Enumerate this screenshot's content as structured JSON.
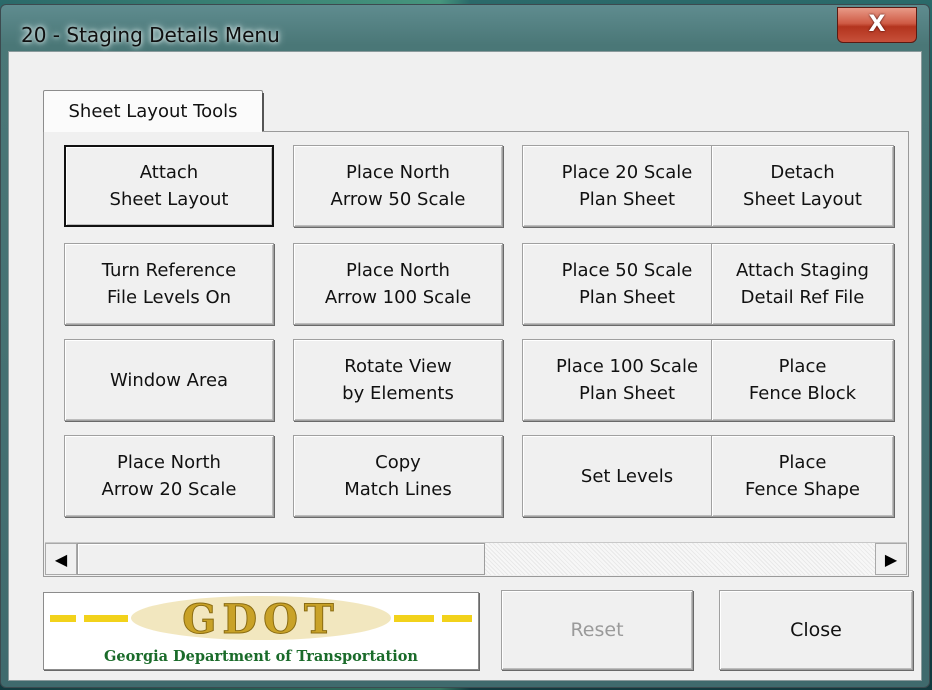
{
  "window": {
    "title": "20 - Staging Details Menu",
    "close_glyph": "X"
  },
  "tabs": [
    {
      "label": "Sheet Layout Tools",
      "selected": true
    }
  ],
  "buttons": [
    {
      "label": "Attach\nSheet Layout",
      "focused": true
    },
    {
      "label": "Place North\nArrow 50 Scale"
    },
    {
      "label": "Place 20 Scale\nPlan Sheet"
    },
    {
      "label": "Detach\nSheet Layout"
    },
    {
      "label": "Turn Reference\nFile Levels On"
    },
    {
      "label": "Place North\nArrow 100 Scale"
    },
    {
      "label": "Place 50 Scale\nPlan Sheet"
    },
    {
      "label": "Attach Staging\nDetail Ref File"
    },
    {
      "label": "Window Area"
    },
    {
      "label": "Rotate View\nby Elements"
    },
    {
      "label": "Place 100 Scale\nPlan Sheet"
    },
    {
      "label": "Place\nFence Block"
    },
    {
      "label": "Place North\nArrow 20 Scale"
    },
    {
      "label": "Copy\nMatch Lines"
    },
    {
      "label": "Set Levels"
    },
    {
      "label": "Place\nFence Shape"
    }
  ],
  "scrollbar": {
    "left_arrow": "◀",
    "right_arrow": "▶",
    "position_fraction": 0
  },
  "logo": {
    "text": "GDOT",
    "caption": "Georgia Department of Transportation",
    "color_gold": "#c9a227",
    "color_yellow": "#f2d21b",
    "color_green": "#1a6b2a"
  },
  "footer": {
    "reset_label": "Reset",
    "reset_enabled": false,
    "close_label": "Close"
  }
}
